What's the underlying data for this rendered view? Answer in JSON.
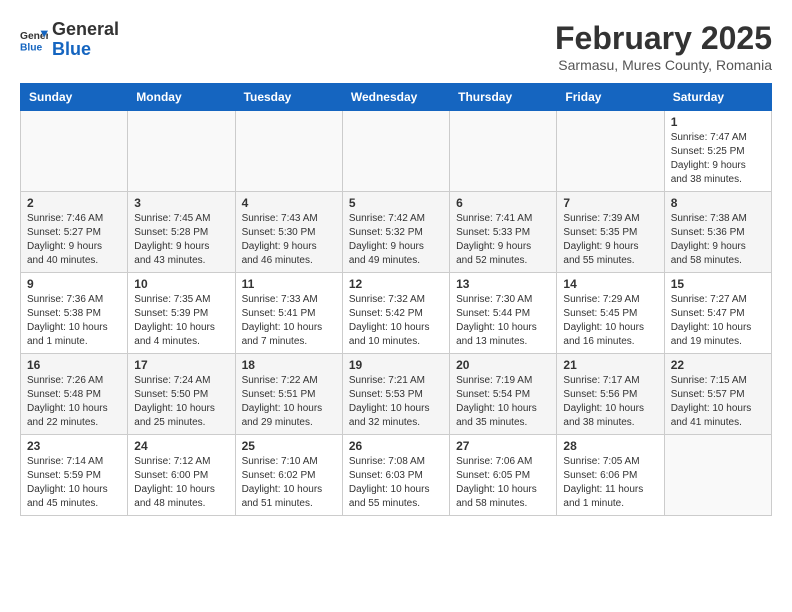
{
  "header": {
    "logo_general": "General",
    "logo_blue": "Blue",
    "month_year": "February 2025",
    "location": "Sarmasu, Mures County, Romania"
  },
  "weekdays": [
    "Sunday",
    "Monday",
    "Tuesday",
    "Wednesday",
    "Thursday",
    "Friday",
    "Saturday"
  ],
  "weeks": [
    [
      {
        "day": "",
        "info": ""
      },
      {
        "day": "",
        "info": ""
      },
      {
        "day": "",
        "info": ""
      },
      {
        "day": "",
        "info": ""
      },
      {
        "day": "",
        "info": ""
      },
      {
        "day": "",
        "info": ""
      },
      {
        "day": "1",
        "info": "Sunrise: 7:47 AM\nSunset: 5:25 PM\nDaylight: 9 hours and 38 minutes."
      }
    ],
    [
      {
        "day": "2",
        "info": "Sunrise: 7:46 AM\nSunset: 5:27 PM\nDaylight: 9 hours and 40 minutes."
      },
      {
        "day": "3",
        "info": "Sunrise: 7:45 AM\nSunset: 5:28 PM\nDaylight: 9 hours and 43 minutes."
      },
      {
        "day": "4",
        "info": "Sunrise: 7:43 AM\nSunset: 5:30 PM\nDaylight: 9 hours and 46 minutes."
      },
      {
        "day": "5",
        "info": "Sunrise: 7:42 AM\nSunset: 5:32 PM\nDaylight: 9 hours and 49 minutes."
      },
      {
        "day": "6",
        "info": "Sunrise: 7:41 AM\nSunset: 5:33 PM\nDaylight: 9 hours and 52 minutes."
      },
      {
        "day": "7",
        "info": "Sunrise: 7:39 AM\nSunset: 5:35 PM\nDaylight: 9 hours and 55 minutes."
      },
      {
        "day": "8",
        "info": "Sunrise: 7:38 AM\nSunset: 5:36 PM\nDaylight: 9 hours and 58 minutes."
      }
    ],
    [
      {
        "day": "9",
        "info": "Sunrise: 7:36 AM\nSunset: 5:38 PM\nDaylight: 10 hours and 1 minute."
      },
      {
        "day": "10",
        "info": "Sunrise: 7:35 AM\nSunset: 5:39 PM\nDaylight: 10 hours and 4 minutes."
      },
      {
        "day": "11",
        "info": "Sunrise: 7:33 AM\nSunset: 5:41 PM\nDaylight: 10 hours and 7 minutes."
      },
      {
        "day": "12",
        "info": "Sunrise: 7:32 AM\nSunset: 5:42 PM\nDaylight: 10 hours and 10 minutes."
      },
      {
        "day": "13",
        "info": "Sunrise: 7:30 AM\nSunset: 5:44 PM\nDaylight: 10 hours and 13 minutes."
      },
      {
        "day": "14",
        "info": "Sunrise: 7:29 AM\nSunset: 5:45 PM\nDaylight: 10 hours and 16 minutes."
      },
      {
        "day": "15",
        "info": "Sunrise: 7:27 AM\nSunset: 5:47 PM\nDaylight: 10 hours and 19 minutes."
      }
    ],
    [
      {
        "day": "16",
        "info": "Sunrise: 7:26 AM\nSunset: 5:48 PM\nDaylight: 10 hours and 22 minutes."
      },
      {
        "day": "17",
        "info": "Sunrise: 7:24 AM\nSunset: 5:50 PM\nDaylight: 10 hours and 25 minutes."
      },
      {
        "day": "18",
        "info": "Sunrise: 7:22 AM\nSunset: 5:51 PM\nDaylight: 10 hours and 29 minutes."
      },
      {
        "day": "19",
        "info": "Sunrise: 7:21 AM\nSunset: 5:53 PM\nDaylight: 10 hours and 32 minutes."
      },
      {
        "day": "20",
        "info": "Sunrise: 7:19 AM\nSunset: 5:54 PM\nDaylight: 10 hours and 35 minutes."
      },
      {
        "day": "21",
        "info": "Sunrise: 7:17 AM\nSunset: 5:56 PM\nDaylight: 10 hours and 38 minutes."
      },
      {
        "day": "22",
        "info": "Sunrise: 7:15 AM\nSunset: 5:57 PM\nDaylight: 10 hours and 41 minutes."
      }
    ],
    [
      {
        "day": "23",
        "info": "Sunrise: 7:14 AM\nSunset: 5:59 PM\nDaylight: 10 hours and 45 minutes."
      },
      {
        "day": "24",
        "info": "Sunrise: 7:12 AM\nSunset: 6:00 PM\nDaylight: 10 hours and 48 minutes."
      },
      {
        "day": "25",
        "info": "Sunrise: 7:10 AM\nSunset: 6:02 PM\nDaylight: 10 hours and 51 minutes."
      },
      {
        "day": "26",
        "info": "Sunrise: 7:08 AM\nSunset: 6:03 PM\nDaylight: 10 hours and 55 minutes."
      },
      {
        "day": "27",
        "info": "Sunrise: 7:06 AM\nSunset: 6:05 PM\nDaylight: 10 hours and 58 minutes."
      },
      {
        "day": "28",
        "info": "Sunrise: 7:05 AM\nSunset: 6:06 PM\nDaylight: 11 hours and 1 minute."
      },
      {
        "day": "",
        "info": ""
      }
    ]
  ]
}
